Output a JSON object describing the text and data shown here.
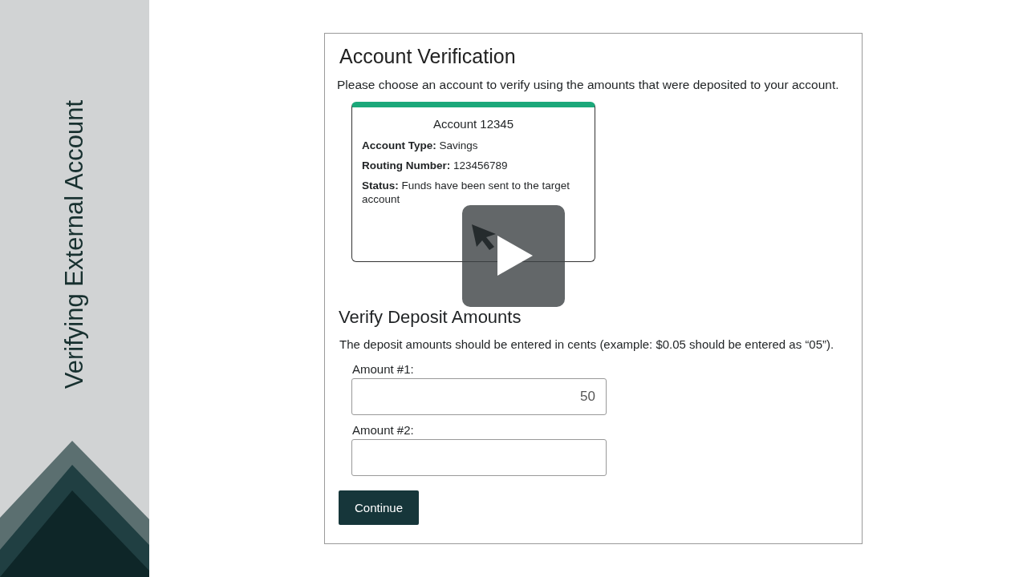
{
  "sidebar": {
    "title": "Verifying External Account"
  },
  "form": {
    "title": "Account Verification",
    "intro": "Please choose an account to verify using the amounts that were deposited to your account.",
    "accounts": [
      {
        "name": "Account 12345",
        "selected": true,
        "fields": [
          "**Account Type:** Savings",
          "**Routing Number:**  123456789",
          "**Status:** Funds have been sent to the target account"
        ]
      }
    ],
    "section_title": "Verify Deposit Amounts",
    "hint": "The deposit amounts should be entered in cents (example: $0.05 should be entered as “05”).",
    "amounts": [
      {
        "label": "Amount #1:",
        "value": "50"
      },
      {
        "label": "Amount #2:"
      }
    ],
    "button": "Continue"
  }
}
